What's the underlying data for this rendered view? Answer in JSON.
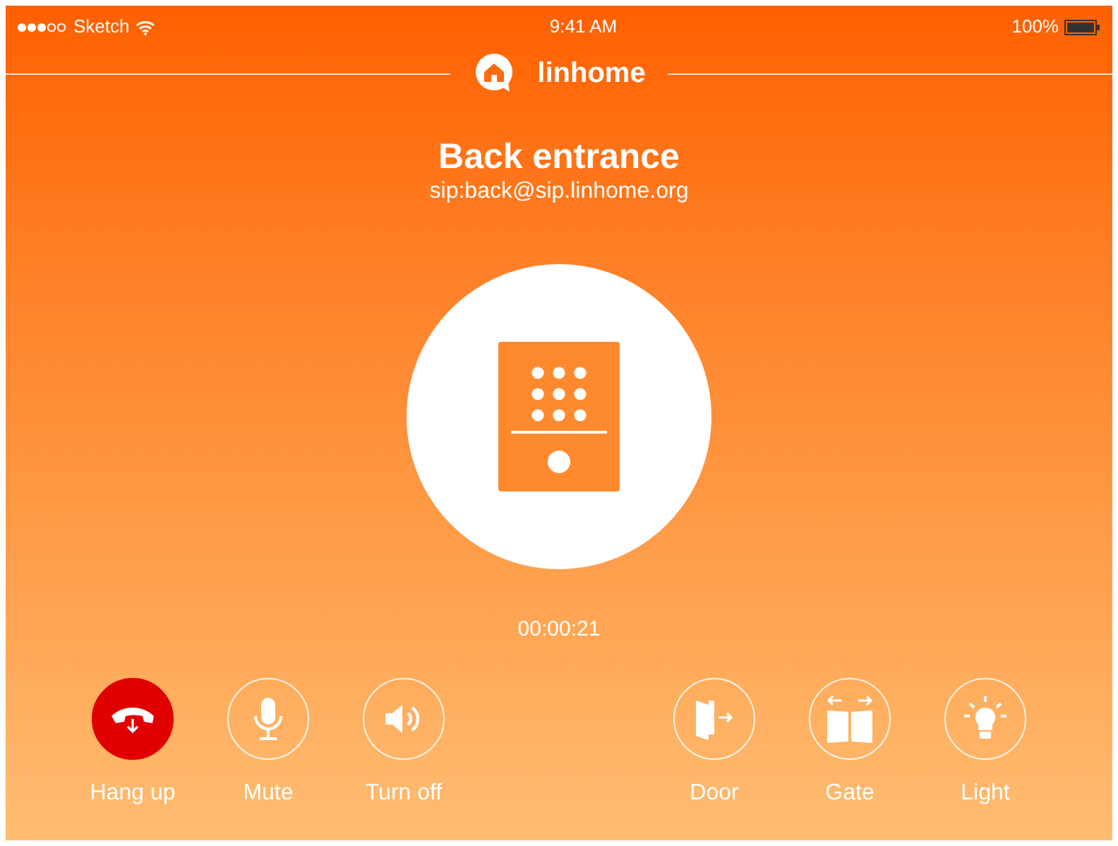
{
  "status_bar": {
    "carrier": "Sketch",
    "time": "9:41 AM",
    "battery": "100%"
  },
  "logo": {
    "text": "linhome"
  },
  "call": {
    "name": "Back entrance",
    "address": "sip:back@sip.linhome.org",
    "duration": "00:00:21"
  },
  "left_buttons": [
    {
      "kind": "hangup",
      "label": "Hang up"
    },
    {
      "kind": "mute",
      "label": "Mute"
    },
    {
      "kind": "speaker",
      "label": "Turn off"
    }
  ],
  "right_buttons": [
    {
      "kind": "door",
      "label": "Door"
    },
    {
      "kind": "gate",
      "label": "Gate"
    },
    {
      "kind": "light",
      "label": "Light"
    }
  ]
}
